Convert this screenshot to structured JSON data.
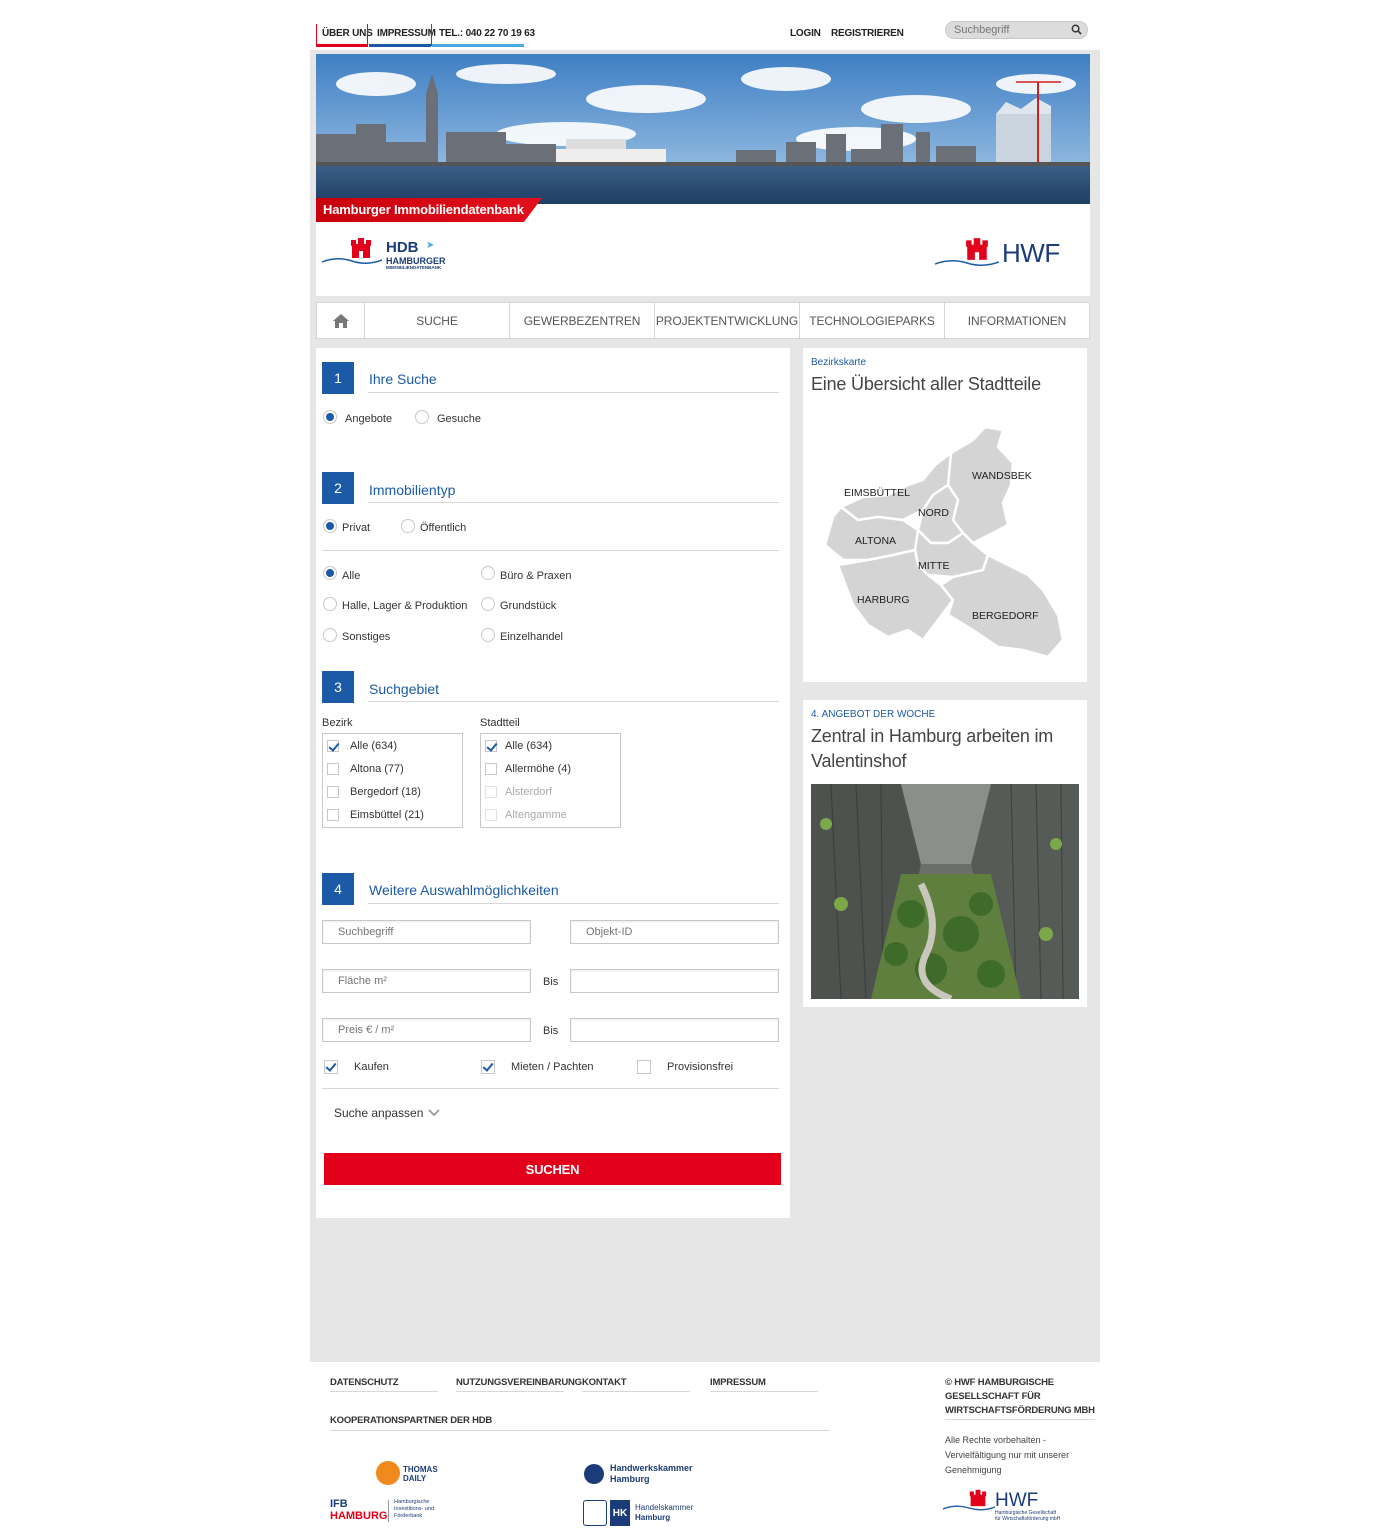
{
  "topnav": {
    "about": "ÜBER UNS",
    "imprint": "IMPRESSUM",
    "phone": "TEL.: 040 22 70 19 63",
    "login": "LOGIN",
    "register": "REGISTRIEREN",
    "search_placeholder": "Suchbegriff"
  },
  "header": {
    "tagline": "Hamburger Immobiliendatenbank",
    "hdb_logo_main": "HDB",
    "hdb_logo_sub1": "HAMBURGER",
    "hdb_logo_sub2": "IMMOBILIENDATENBANK",
    "hwf_logo": "HWF"
  },
  "mainnav": {
    "items": [
      "SUCHE",
      "GEWERBEZENTREN",
      "PROJEKTENTWICKLUNG",
      "TECHNOLOGIEPARKS",
      "INFORMATIONEN"
    ]
  },
  "form": {
    "step1": {
      "num": "1",
      "title": "Ihre Suche",
      "options": [
        "Angebote",
        "Gesuche"
      ]
    },
    "step2": {
      "num": "2",
      "title": "Immobilientyp",
      "owner": [
        "Privat",
        "Öffentlich"
      ],
      "types": [
        "Alle",
        "Büro & Praxen",
        "Halle, Lager & Produktion",
        "Grundstück",
        "Sonstiges",
        "Einzelhandel"
      ]
    },
    "step3": {
      "num": "3",
      "title": "Suchgebiet",
      "bezirk_label": "Bezirk",
      "stadtteil_label": "Stadtteil",
      "bezirke": [
        "Alle (634)",
        "Altona (77)",
        "Bergedorf (18)",
        "Eimsbüttel (21)"
      ],
      "stadtteile": [
        "Alle (634)",
        "Allermöhe (4)",
        "Alsterdorf",
        "Altengamme"
      ]
    },
    "step4": {
      "num": "4",
      "title": "Weitere Auswahlmöglichkeiten",
      "keyword_placeholder": "Suchbegriff",
      "objectid_placeholder": "Objekt-ID",
      "area_placeholder": "Fläche m²",
      "price_placeholder": "Preis € / m²",
      "bis": "Bis",
      "checks": [
        "Kaufen",
        "Mieten / Pachten",
        "Provisionsfrei"
      ],
      "adjust": "Suche anpassen"
    },
    "submit": "SUCHEN"
  },
  "map_card": {
    "kicker": "Bezirkskarte",
    "title": "Eine Übersicht aller Stadtteile",
    "districts": [
      "EIMSBÜTTEL",
      "WANDSBEK",
      "NORD",
      "ALTONA",
      "MITTE",
      "HARBURG",
      "BERGEDORF"
    ]
  },
  "offer_card": {
    "kicker": "4. ANGEBOT DER WOCHE",
    "title_line1": "Zentral in Hamburg arbeiten im",
    "title_line2": "Valentinshof"
  },
  "footer": {
    "links": [
      "DATENSCHUTZ",
      "NUTZUNGSVEREINBARUNG",
      "KONTAKT",
      "IMPRESSUM"
    ],
    "partners_heading": "KOOPERATIONSPARTNER DER HDB",
    "partners": {
      "thomas1": "THOMAS",
      "thomas2": "DAILY",
      "hwk1": "Handwerkskammer",
      "hwk2": "Hamburg",
      "ifb1": "IFB",
      "ifb2": "HAMBURG",
      "ifb_sub1": "Hamburgische",
      "ifb_sub2": "Investitions- und",
      "ifb_sub3": "Förderbank",
      "hk_badge": "HK",
      "hk1": "Handelskammer",
      "hk2": "Hamburg"
    },
    "copyright_line1": "© HWF HAMBURGISCHE",
    "copyright_line2": "GESELLSCHAFT FÜR",
    "copyright_line3": "WIRTSCHAFTSFÖRDERUNG MBH",
    "rights_line1": "Alle Rechte vorbehalten -",
    "rights_line2": "Vervielfältigung nur mit unserer",
    "rights_line3": "Genehmigung",
    "hwf_logo": "HWF",
    "hwf_sub1": "Hamburgische Gesellschaft",
    "hwf_sub2": "für Wirtschaftsförderung mbH"
  },
  "colors": {
    "brand_blue": "#1a5aa6",
    "brand_red": "#e3001b"
  }
}
